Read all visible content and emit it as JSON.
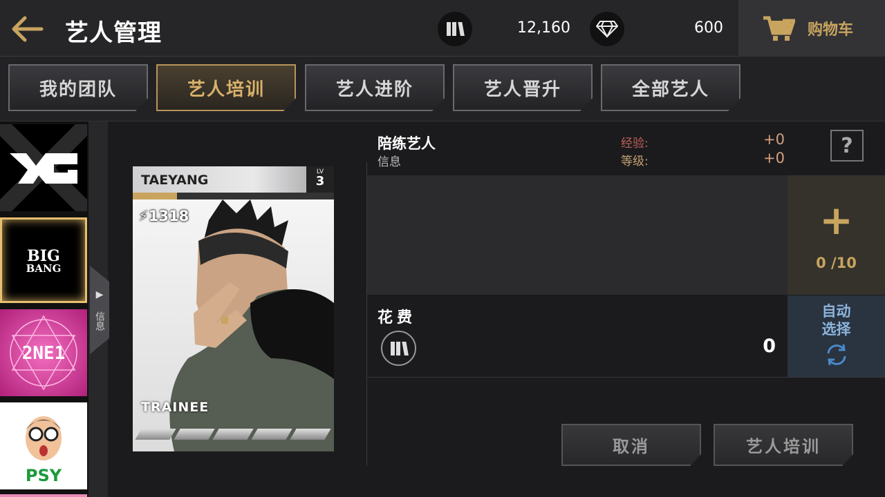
{
  "header": {
    "title": "艺人管理",
    "currency1": {
      "icon": "album-coin-icon",
      "value": "12,160"
    },
    "currency2": {
      "icon": "diamond-icon",
      "value": "600"
    },
    "cart_label": "购物车"
  },
  "tabs": [
    {
      "label": "我的团队",
      "active": false
    },
    {
      "label": "艺人培训",
      "active": true
    },
    {
      "label": "艺人进阶",
      "active": false
    },
    {
      "label": "艺人晋升",
      "active": false
    },
    {
      "label": "全部艺人",
      "active": false
    }
  ],
  "sidebar": {
    "groups": [
      {
        "name": "YG",
        "selected": false
      },
      {
        "name": "BIGBANG",
        "selected": true
      },
      {
        "name": "2NE1",
        "selected": false
      },
      {
        "name": "PSY",
        "selected": false
      }
    ],
    "info_tab": "信息"
  },
  "card": {
    "name": "TAEYANG",
    "level_label": "LV",
    "level": "3",
    "power": "1318",
    "rank": "TRAINEE",
    "stars_filled": 0,
    "stars_total": 5,
    "xp_fraction": 0.22
  },
  "training": {
    "partner_label": "陪练艺人",
    "info_label": "信息",
    "exp_label": "经验:",
    "exp_value": "+0",
    "level_label": "等级:",
    "level_value": "+0",
    "help": "?",
    "slot_count": "0 /10",
    "cost_label": "花费",
    "cost_value": "0",
    "auto_line1": "自动",
    "auto_line2": "选择"
  },
  "buttons": {
    "cancel": "取消",
    "train": "艺人培训"
  },
  "colors": {
    "accent_gold": "#c8a45e",
    "auto_blue": "#8cb4dc"
  }
}
